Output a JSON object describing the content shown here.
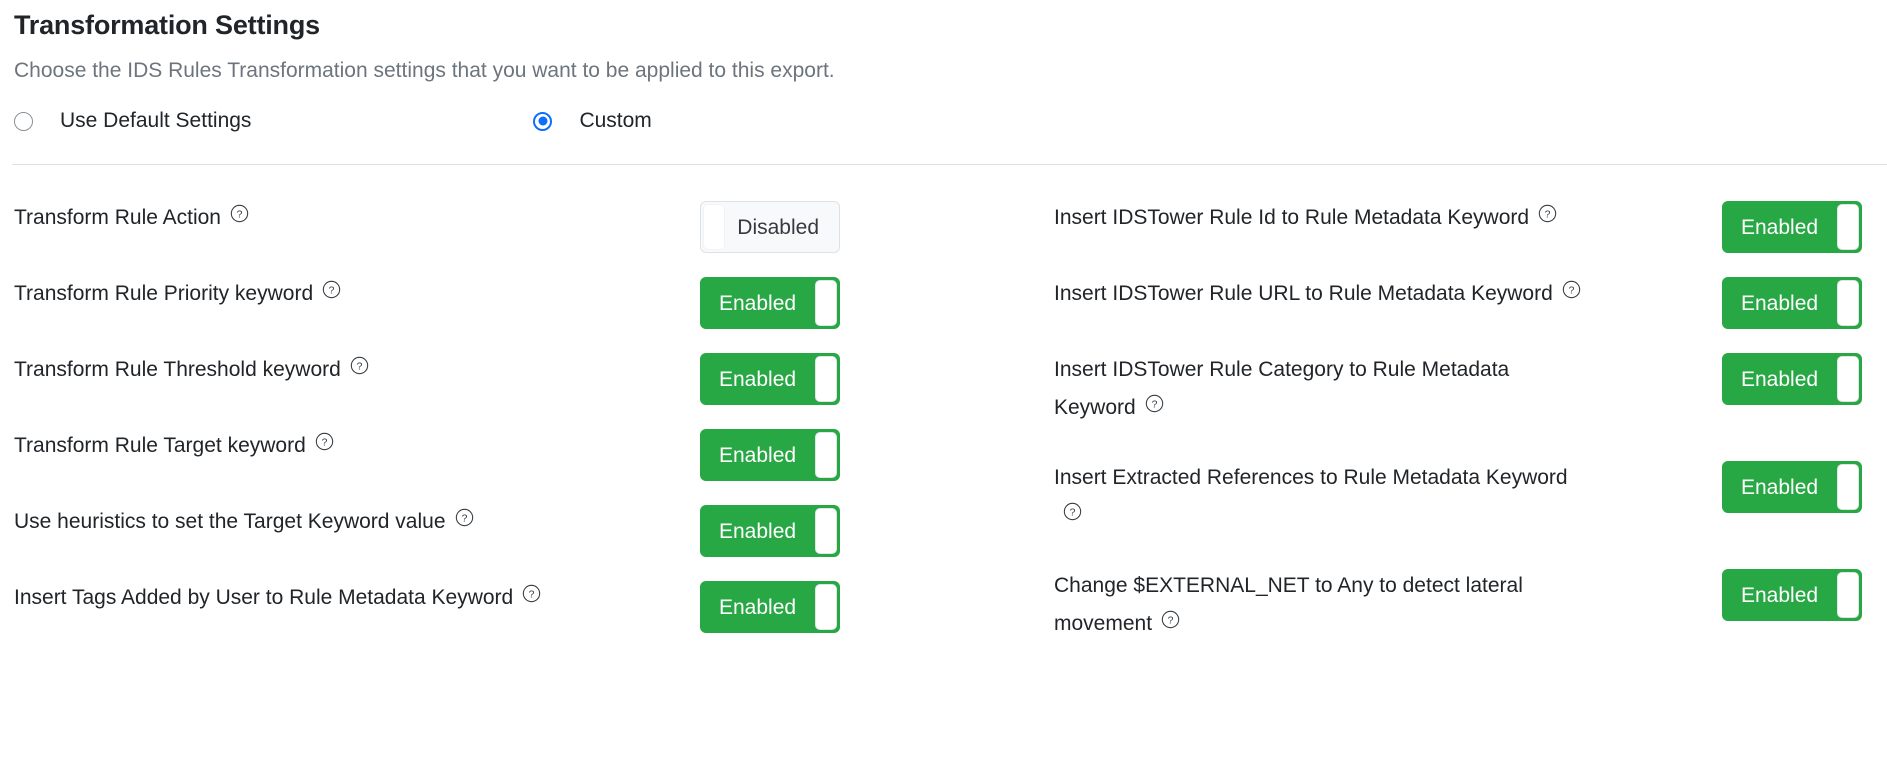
{
  "header": {
    "title": "Transformation Settings",
    "subtitle": "Choose the IDS Rules Transformation settings that you want to be applied to this export."
  },
  "mode_selector": {
    "options": [
      {
        "label": "Use Default Settings",
        "selected": false
      },
      {
        "label": "Custom",
        "selected": true
      }
    ]
  },
  "colors": {
    "enabled_green": "#28a745",
    "radio_blue": "#0d6efd",
    "subtitle_gray": "#6c757d",
    "divider_gray": "#dee2e6",
    "disabled_bg": "#f8f9fa"
  },
  "toggle_states": {
    "enabled_label": "Enabled",
    "disabled_label": "Disabled"
  },
  "settings": {
    "left_column": [
      {
        "label": "Transform Rule Action",
        "help": "help-icon",
        "state": "Disabled",
        "on": false
      },
      {
        "label": "Transform Rule Priority keyword",
        "help": "help-icon",
        "state": "Enabled",
        "on": true
      },
      {
        "label": "Transform Rule Threshold keyword",
        "help": "help-icon",
        "state": "Enabled",
        "on": true
      },
      {
        "label": "Transform Rule Target keyword",
        "help": "help-icon",
        "state": "Enabled",
        "on": true
      },
      {
        "label": "Use heuristics to set the Target Keyword value",
        "help": "help-icon",
        "state": "Enabled",
        "on": true
      },
      {
        "label": "Insert Tags Added by User to Rule Metadata Keyword",
        "help": "help-icon",
        "state": "Enabled",
        "on": true
      }
    ],
    "right_column": [
      {
        "label": "Insert IDSTower Rule Id to Rule Metadata Keyword",
        "help": "help-icon",
        "state": "Enabled",
        "on": true
      },
      {
        "label": "Insert IDSTower Rule URL to Rule Metadata Keyword",
        "help": "help-icon",
        "state": "Enabled",
        "on": true
      },
      {
        "label": "Insert IDSTower Rule Category to Rule Metadata Keyword",
        "help": "help-icon",
        "state": "Enabled",
        "on": true
      },
      {
        "label": "Insert Extracted References to Rule Metadata Keyword",
        "help": "help-icon",
        "state": "Enabled",
        "on": true
      },
      {
        "label": "Change $EXTERNAL_NET to Any to detect lateral movement",
        "help": "help-icon",
        "state": "Enabled",
        "on": true
      }
    ]
  }
}
